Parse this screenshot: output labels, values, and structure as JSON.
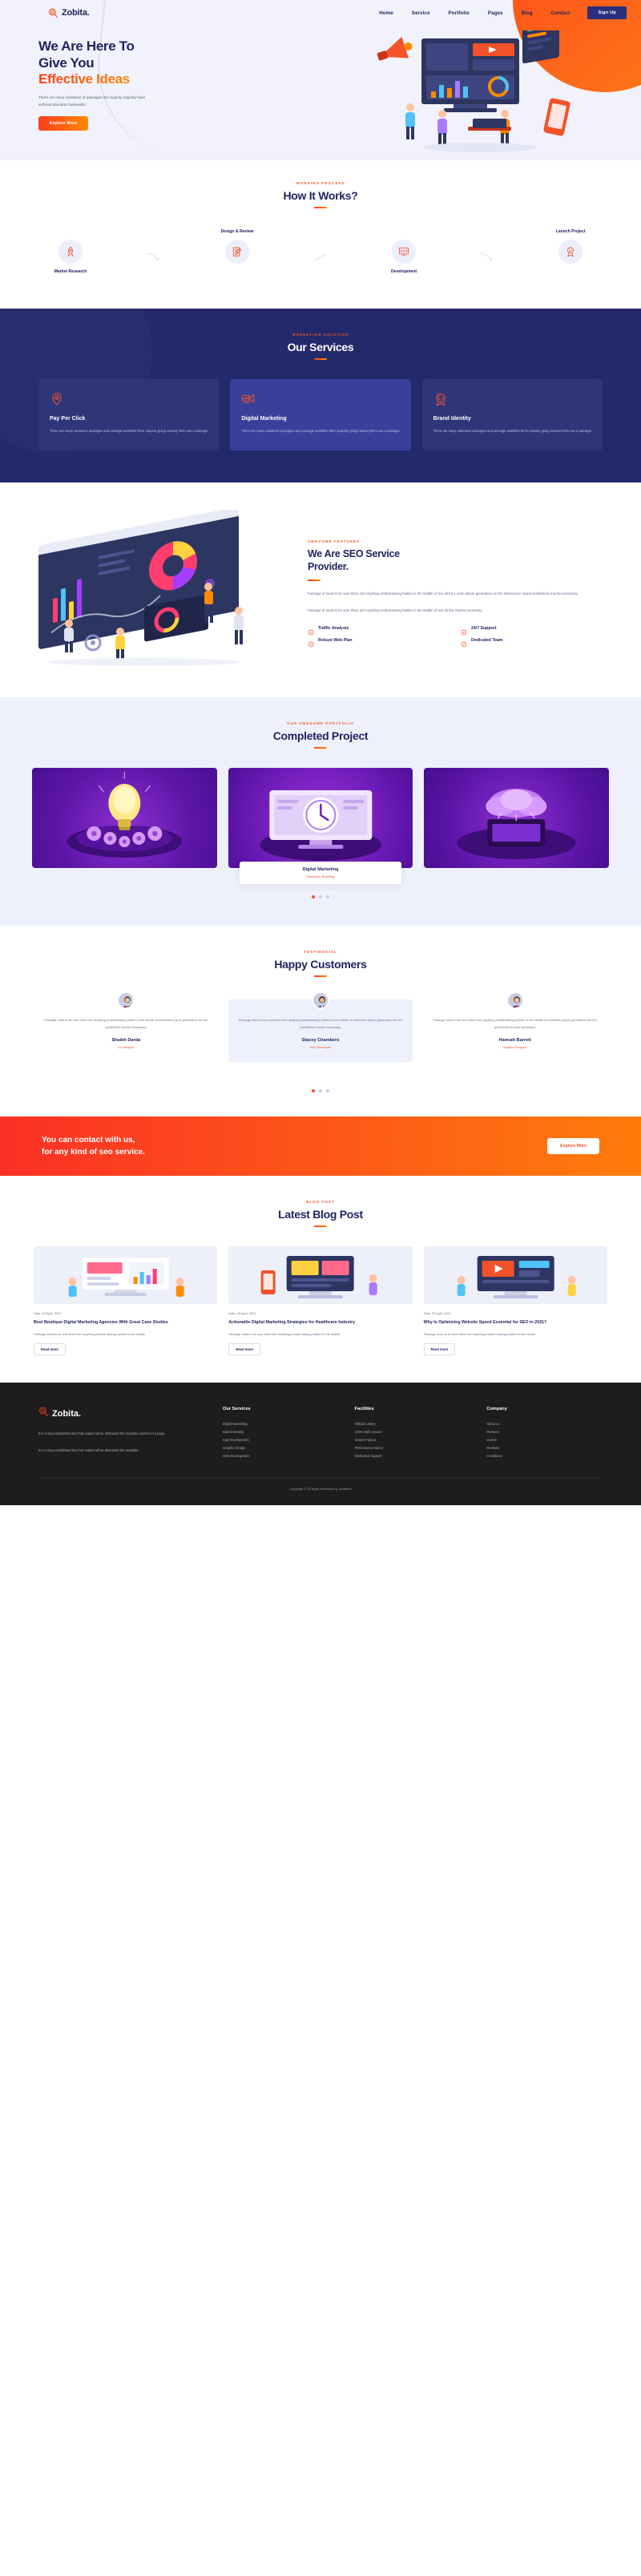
{
  "brand": {
    "name": "Zobita.",
    "logo_icon": "target-search-icon"
  },
  "nav": {
    "links": [
      {
        "label": "Home"
      },
      {
        "label": "Service"
      },
      {
        "label": "Portfolio"
      },
      {
        "label": "Pages"
      },
      {
        "label": "Blog"
      },
      {
        "label": "Contact"
      }
    ],
    "signup_label": "Sign Up"
  },
  "hero": {
    "title_line1": "We Are Here To",
    "title_line2": "Give You",
    "title_accent": "Effective Ideas",
    "paragraph": "There are many variations of passages the majority majority have suffered alteration believable.",
    "button": "Explore More"
  },
  "how": {
    "eyebrow": "WORKING PROCESS",
    "title": "How It Works?",
    "steps": [
      {
        "label": "Market Research",
        "icon": "rocket-icon"
      },
      {
        "label": "Design & Review",
        "icon": "document-pen-icon"
      },
      {
        "label": "Development",
        "icon": "code-gear-icon"
      },
      {
        "label": "Launch Project",
        "icon": "launch-badge-icon"
      }
    ]
  },
  "services": {
    "eyebrow": "MARKETING SOLUTION",
    "title": "Our Services",
    "cards": [
      {
        "title": "Pay Per Click",
        "icon": "click-target-icon",
        "text": "There are many variations passages and passage available them majority going rassing them use a passage"
      },
      {
        "title": "Digital Marketing",
        "icon": "megaphone-screen-icon",
        "text": "There are many variations passages and passage available them majority going rassing them use a passage"
      },
      {
        "title": "Brand Identity",
        "icon": "brand-badge-icon",
        "text": "There are many variations passages and passage available them majority going rassing them use a passage"
      }
    ]
  },
  "seo": {
    "eyebrow": "AWESOME FEATURES",
    "title_line1": "We Are SEO Service",
    "title_line2": "Provider.",
    "paragraph1": "Passage of need to be sure there isn't anything embarrassing hidden in the middle of text all the Lorem Ipsum generators on the Internet ten repeat predefined chunks necessary.",
    "paragraph2": "Passage of need to be sure there isn't anything embarrassing hidden in the middle of text all the chunks necessary.",
    "features": [
      {
        "label": "Traffic Analysis",
        "icon": "check-badge-icon"
      },
      {
        "label": "24/7 Support",
        "icon": "check-badge-icon"
      },
      {
        "label": "Robust Web Plan",
        "icon": "check-badge-icon"
      },
      {
        "label": "Dedicated Team",
        "icon": "check-badge-icon"
      }
    ]
  },
  "portfolio": {
    "eyebrow": "OUR AWESOME PORTFOLIO",
    "title": "Completed Project",
    "items": [
      {
        "alt": "idea-bulb-gears-illustration"
      },
      {
        "alt": "clock-monitor-illustration",
        "caption_title": "Digital Marketing",
        "caption_sub": "Marketing, Branding"
      },
      {
        "alt": "cloud-phone-illustration"
      }
    ],
    "dots": [
      {
        "active": true
      },
      {
        "active": false
      },
      {
        "active": false
      }
    ]
  },
  "testimonial": {
    "eyebrow": "TESTIMONIAL",
    "title": "Happy Customers",
    "cards": [
      {
        "text": "Passage need to be sure there isn't anything embarrassing hidden in the middle of anthesem Ipsum generators the ten predefined chunks necessary.",
        "name": "Shaikh Darda",
        "role": "UI Designer",
        "avatar": "avatar-woman-1"
      },
      {
        "text": "Passage need to be sure there isn't anything embarrassing hidden in the middle of anthesem Ipsum generators the ten predefined chunks necessary.",
        "name": "Stacey Chambers",
        "role": "Web Developer",
        "avatar": "avatar-man-1"
      },
      {
        "text": "Passage need to be sure there isn't anything embarrassing hidden in the middle of anthesem Ipsum generators the ten predefined chunks necessary.",
        "name": "Hannah Barrett",
        "role": "Graphic Designer",
        "avatar": "avatar-woman-2"
      }
    ],
    "dots": [
      {
        "active": true
      },
      {
        "active": false
      },
      {
        "active": false
      }
    ]
  },
  "cta": {
    "line1": "You can contact with us,",
    "line2": "for any kind of seo service.",
    "button": "Explore More"
  },
  "blog": {
    "eyebrow": "BLOG POST",
    "title": "Latest Blog Post",
    "posts": [
      {
        "date_label": "Date:",
        "date": "03 April, 2021",
        "title": "Best Boutique Digital Marketing Agencies With Great Case Studies",
        "text": "Passage need to be sure there isn't anything embas rassing hidden in the middle.",
        "more": "Read more",
        "img": "analytics-dashboard-illustration"
      },
      {
        "date_label": "Date:",
        "date": "03 April, 2021",
        "title": "Actionable Digital Marketing Strategies for Healthcare Industry",
        "text": "Passage need to be sure there isn't anything embas rassing hidden in the middle.",
        "more": "Read more",
        "img": "mobile-chart-illustration"
      },
      {
        "date_label": "Date:",
        "date": "03 April, 2021",
        "title": "Why Is Optimizing Website Speed Essential for SEO in 2021?",
        "text": "Passage need to be sure there isn't anything embas rassing hidden in the middle.",
        "more": "Read more",
        "img": "speed-monitor-illustration"
      }
    ]
  },
  "footer": {
    "brand": "Zobita.",
    "about_p1": "It is a long established fact that reader will be distracted the readable content of a page.",
    "about_p2": "It is a long established fact that reader will be distracted the readable",
    "columns": [
      {
        "heading": "Our Services",
        "links": [
          {
            "label": "Digital Marketing"
          },
          {
            "label": "Brand Idenelty"
          },
          {
            "label": "App Development"
          },
          {
            "label": "Graphic Design"
          },
          {
            "label": "Web Development"
          }
        ]
      },
      {
        "heading": "Facilities",
        "links": [
          {
            "label": "Official Lottery"
          },
          {
            "label": "100% Safe Secure"
          },
          {
            "label": "Instant Payout"
          },
          {
            "label": "Performance Bonut"
          },
          {
            "label": "Dedicated Support"
          }
        ]
      },
      {
        "heading": "Company",
        "links": [
          {
            "label": "About us"
          },
          {
            "label": "Partners"
          },
          {
            "label": "Career"
          },
          {
            "label": "Reviews"
          },
          {
            "label": "Conditions"
          }
        ]
      }
    ],
    "copyright": "Copyright © All Right Reserved by whatever"
  },
  "colors": {
    "navy": "#1f2460",
    "deep_navy": "#232a6b",
    "orange": "#f4522a",
    "orange_grad_start": "#fb3c1e",
    "orange_grad_end": "#ff8a00",
    "hero_bg": "#f1f2fb",
    "light_bg": "#eef1fb",
    "footer_bg": "#1d1d1d"
  }
}
